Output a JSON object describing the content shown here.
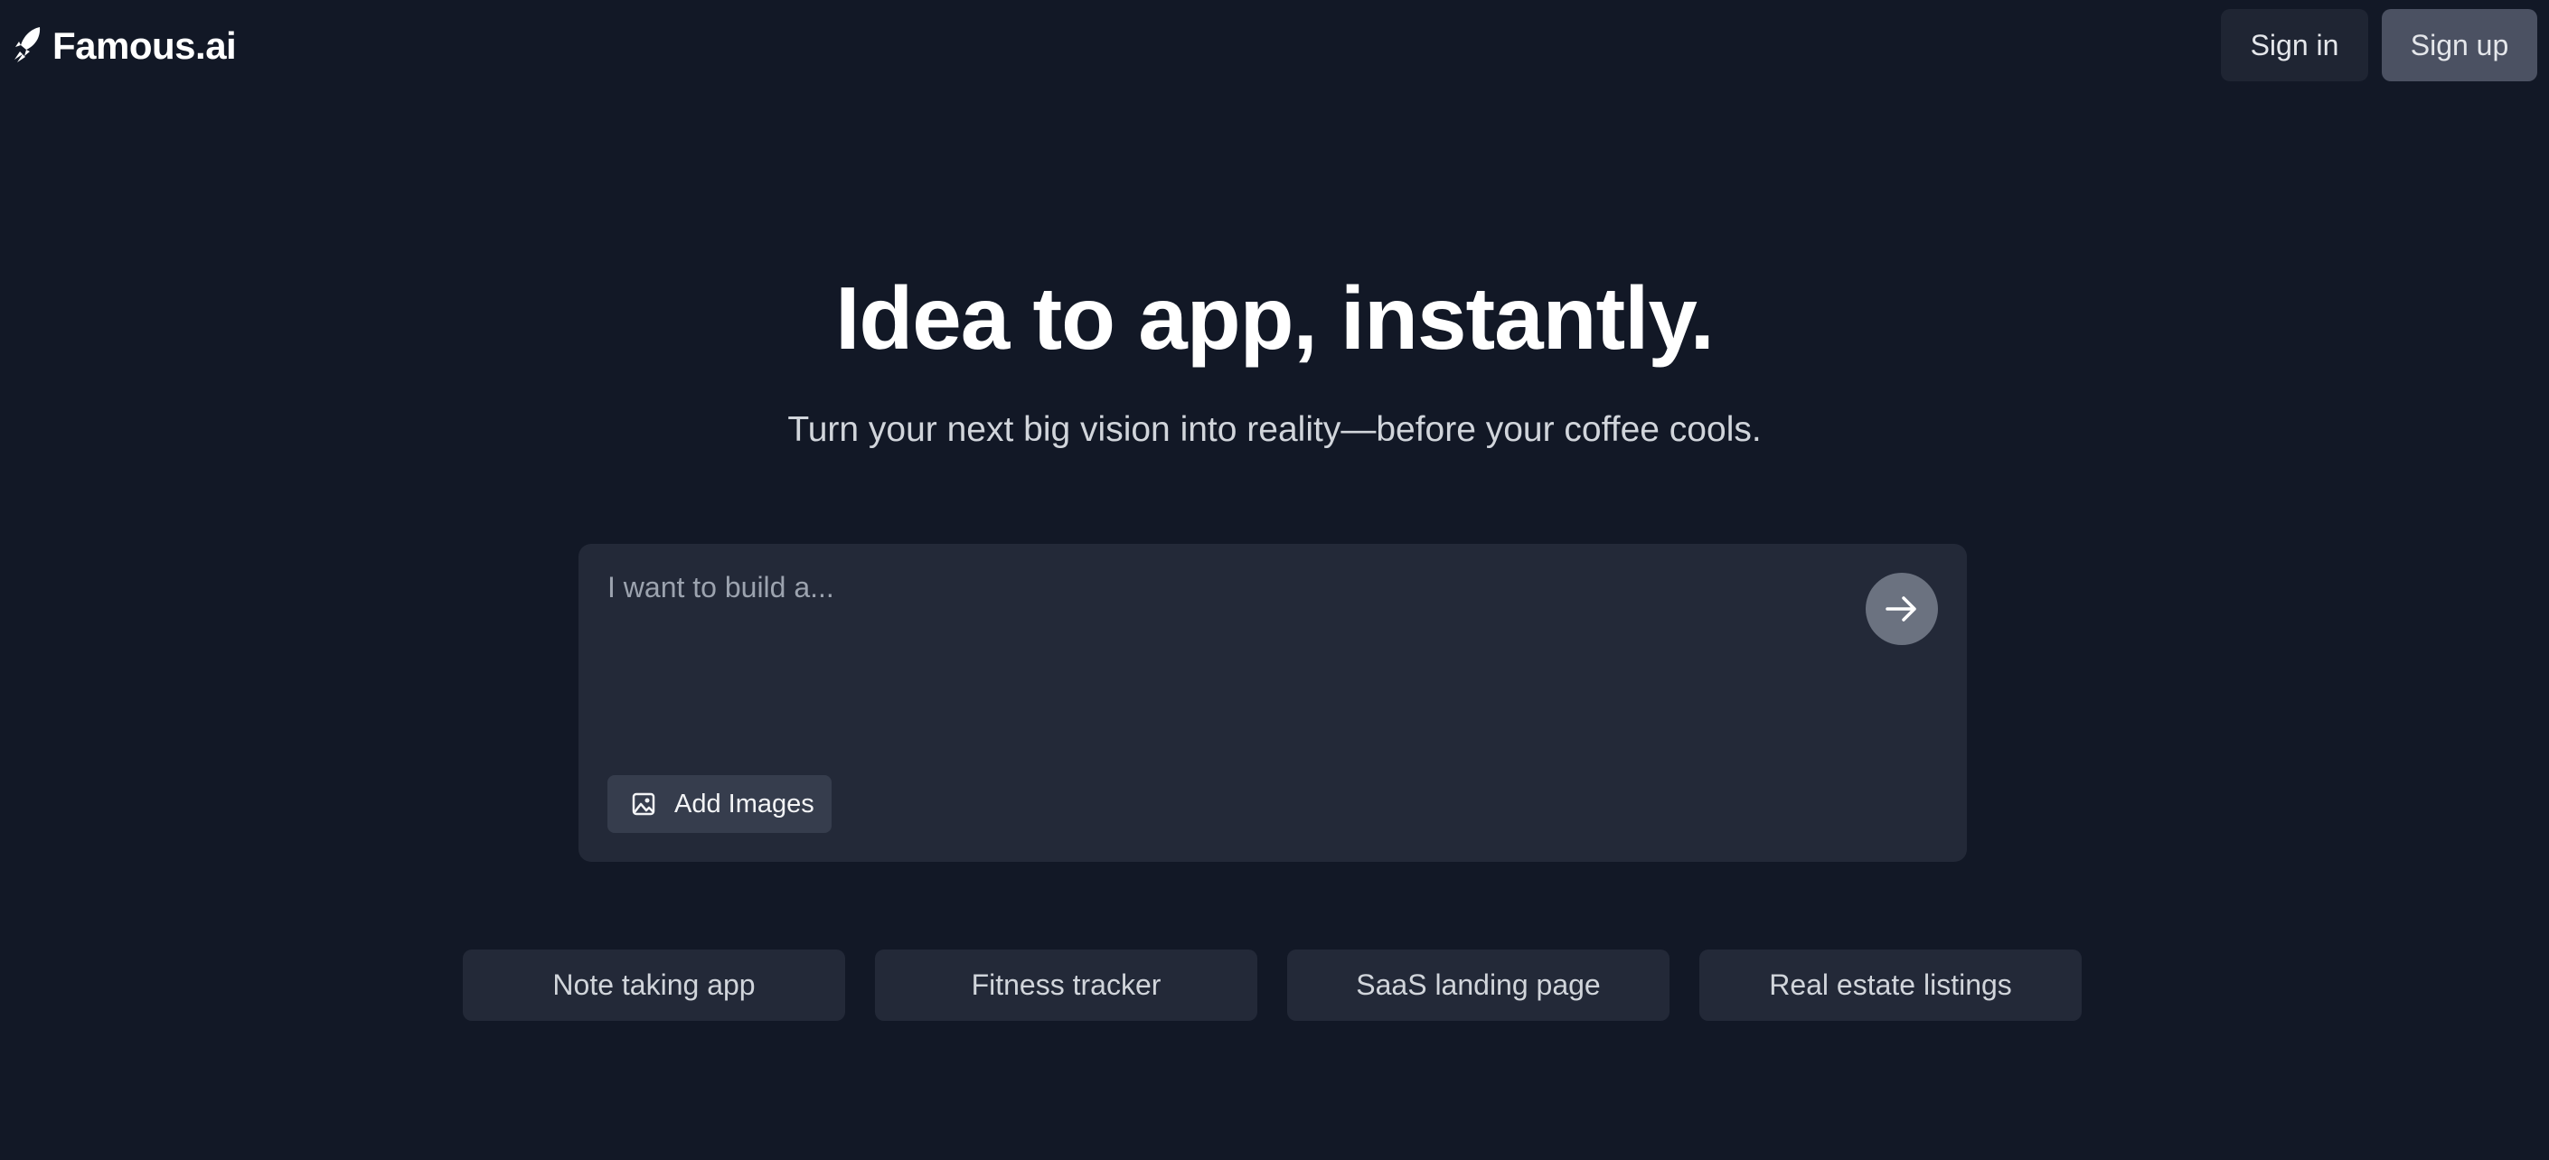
{
  "header": {
    "logo_icon": "rocket-icon",
    "logo_text": "Famous.ai",
    "signin_label": "Sign in",
    "signup_label": "Sign up"
  },
  "hero": {
    "title": "Idea to app, instantly.",
    "subtitle": "Turn your next big vision into reality—before your coffee cools."
  },
  "prompt": {
    "placeholder": "I want to build a...",
    "value": "",
    "send_icon": "arrow-right-icon",
    "add_images_icon": "image-icon",
    "add_images_label": "Add Images"
  },
  "suggestions": [
    {
      "label": "Note taking app"
    },
    {
      "label": "Fitness tracker"
    },
    {
      "label": "SaaS landing page"
    },
    {
      "label": "Real estate listings"
    }
  ],
  "colors": {
    "background": "#121826",
    "panel": "#232938",
    "signup_bg": "#4b5162",
    "send_bg": "#6b7280"
  }
}
